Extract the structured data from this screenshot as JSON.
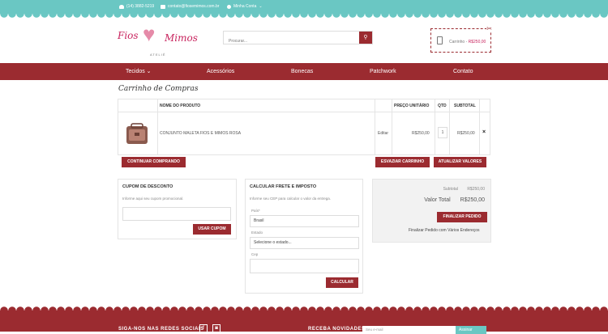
{
  "topbar": {
    "phone": "(14) 3882-5219",
    "email": "contato@fiosemimos.com.br",
    "account": "Minha Conta"
  },
  "logo": {
    "word1": "Fios",
    "word2": "Mimos",
    "sub": "ATELIÊ"
  },
  "search": {
    "placeholder": "Procurar..."
  },
  "cart": {
    "label": "Carrinho -",
    "amount": "R$250,00"
  },
  "nav": {
    "items": [
      "Tecidos ⌄",
      "Acessórios",
      "Bonecas",
      "Patchwork",
      "Contato"
    ]
  },
  "page": {
    "title": "Carrinho de Compras"
  },
  "table": {
    "headers": {
      "name": "NOME DO PRODUTO",
      "unit": "PREÇO UNITÁRIO",
      "qty": "QTD",
      "subtotal": "SUBTOTAL"
    },
    "rows": [
      {
        "name": "CONJUNTO MALETA FIOS E MIMOS ROSA",
        "edit": "Editar",
        "unit": "R$250,00",
        "qty": "1",
        "subtotal": "R$250,00",
        "remove": "×"
      }
    ]
  },
  "actions": {
    "continue": "CONTINUAR COMPRANDO",
    "empty": "ESVAZIAR CARRINHO",
    "update": "ATUALIZAR VALORES"
  },
  "coupon": {
    "title": "CUPOM DE DESCONTO",
    "desc": "Informe aqui seu cupom promocional.",
    "button": "USAR CUPOM"
  },
  "shipping": {
    "title": "CALCULAR FRETE E IMPOSTO",
    "desc": "Informe seu CEP para calcular o valor da entrega.",
    "country_label": "País*",
    "country_value": "Brasil",
    "state_label": "Estado",
    "state_value": "Selecione o estado...",
    "zip_label": "Cep",
    "button": "CALCULAR"
  },
  "totals": {
    "subtotal_label": "Subtotal",
    "subtotal_value": "R$250,00",
    "total_label": "Valor Total",
    "total_value": "R$250,00",
    "checkout": "FINALIZAR PEDIDO",
    "multi": "Finalizar Pedido com Vários Endereços"
  },
  "footer": {
    "social_label": "SIGA-NOS NAS REDES SOCIAIS",
    "newsletter_label": "RECEBA NOVIDADES",
    "newsletter_placeholder": "Seu e-mail",
    "newsletter_button": "Assinar"
  },
  "colors": {
    "teal": "#6ac7c3",
    "brand_red": "#9b2b30",
    "logo_pink": "#c8245e"
  }
}
